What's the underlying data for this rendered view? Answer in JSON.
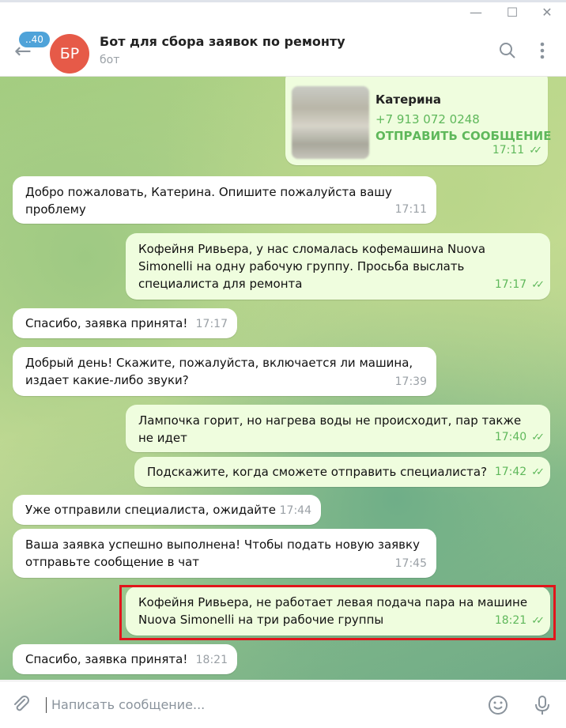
{
  "window": {
    "minimize": "—",
    "maximize": "☐",
    "close": "✕"
  },
  "header": {
    "unread_badge": "..40",
    "avatar_initials": "БР",
    "title": "Бот для сбора заявок по ремонту",
    "subtitle": "бот",
    "icons": [
      "back-arrow-icon",
      "search-icon",
      "more-vertical-icon"
    ]
  },
  "contact_card": {
    "name": "Катерина",
    "phone": "+7 913 072 0248",
    "action": "ОТПРАВИТЬ СООБЩЕНИЕ",
    "time": "17:11"
  },
  "messages": [
    {
      "dir": "in",
      "text": "Добро пожаловать, Катерина. Опишите пожалуйста вашу проблему",
      "time": "17:11"
    },
    {
      "dir": "out",
      "text": "Кофейня Ривьера, у нас сломалась кофемашина Nuova Simonelli на одну рабочую группу. Просьба выслать специалиста для ремонта",
      "time": "17:17"
    },
    {
      "dir": "in",
      "text": "Спасибо, заявка принята!",
      "time": "17:17"
    },
    {
      "dir": "in",
      "text": "Добрый день! Скажите, пожалуйста, включается ли машина, издает какие-либо звуки?",
      "time": "17:39"
    },
    {
      "dir": "out",
      "text": "Лампочка горит, но нагрева воды не происходит, пар также не идет",
      "time": "17:40"
    },
    {
      "dir": "out",
      "text": "Подскажите, когда сможете отправить специалиста?",
      "time": "17:42"
    },
    {
      "dir": "in",
      "text": "Уже отправили специалиста, ожидайте",
      "time": "17:44"
    },
    {
      "dir": "in",
      "text": "Ваша заявка успешно выполнена! Чтобы подать новую заявку отправьте сообщение в чат",
      "time": "17:45"
    },
    {
      "dir": "out",
      "text": "Кофейня Ривьера, не работает левая подача пара на машине Nuova Simonelli на три рабочие группы",
      "time": "18:21"
    },
    {
      "dir": "in",
      "text": "Спасибо, заявка принята!",
      "time": "18:21"
    }
  ],
  "input": {
    "placeholder": "Написать сообщение...",
    "icons": [
      "attach-icon",
      "emoji-icon",
      "microphone-icon"
    ]
  },
  "colors": {
    "incoming_bg": "#ffffff",
    "outgoing_bg": "#effdde",
    "accent_green": "#5fb85b",
    "highlight_border": "#e2151b",
    "avatar_bg": "#e65a48"
  }
}
